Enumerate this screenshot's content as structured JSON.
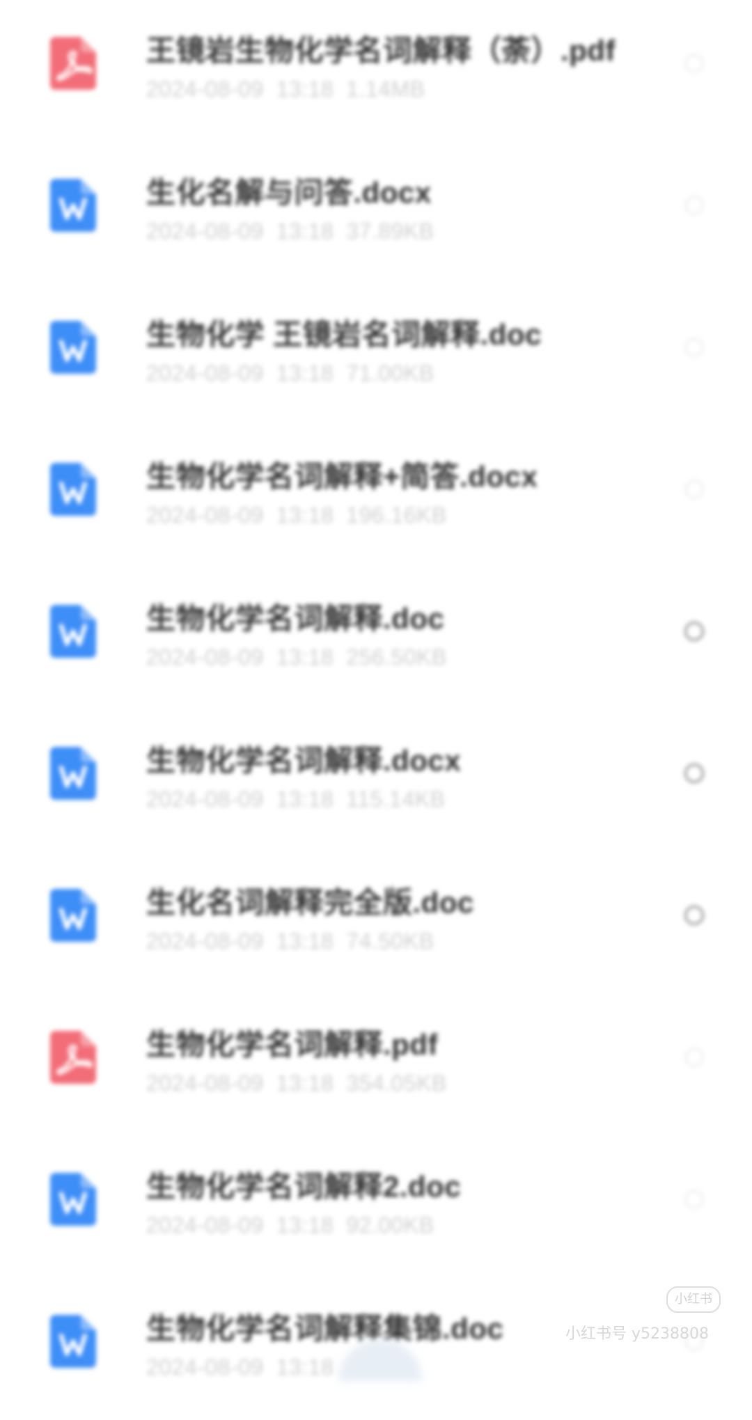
{
  "files": [
    {
      "name": "王镜岩生物化学名词解释（荼）.pdf",
      "date": "2024-08-09",
      "time": "13:18",
      "size": "1.14MB",
      "icon": "pdf-icon"
    },
    {
      "name": "生化名解与问答.docx",
      "date": "2024-08-09",
      "time": "13:18",
      "size": "37.89KB",
      "icon": "word-doc-icon"
    },
    {
      "name": "生物化学 王镜岩名词解释.doc",
      "date": "2024-08-09",
      "time": "13:18",
      "size": "71.00KB",
      "icon": "word-doc-icon"
    },
    {
      "name": "生物化学名词解释+简答.docx",
      "date": "2024-08-09",
      "time": "13:18",
      "size": "196.16KB",
      "icon": "word-doc-icon"
    },
    {
      "name": "生物化学名词解释.doc",
      "date": "2024-08-09",
      "time": "13:18",
      "size": "256.50KB",
      "icon": "word-doc-icon"
    },
    {
      "name": "生物化学名词解释.docx",
      "date": "2024-08-09",
      "time": "13:18",
      "size": "115.14KB",
      "icon": "word-doc-icon"
    },
    {
      "name": "生化名词解释完全版.doc",
      "date": "2024-08-09",
      "time": "13:18",
      "size": "74.50KB",
      "icon": "word-doc-icon"
    },
    {
      "name": "生物化学名词解释.pdf",
      "date": "2024-08-09",
      "time": "13:18",
      "size": "354.05KB",
      "icon": "pdf-icon"
    },
    {
      "name": "生物化学名词解释2.doc",
      "date": "2024-08-09",
      "time": "13:18",
      "size": "92.00KB",
      "icon": "word-doc-icon"
    },
    {
      "name": "生物化学名词解释集锦.doc",
      "date": "2024-08-09",
      "time": "13:18",
      "size": "",
      "icon": "word-doc-icon"
    }
  ],
  "watermark": {
    "logo": "小红书",
    "text": "小红书号 y5238808"
  },
  "colors": {
    "pdf": "#f26d78",
    "word": "#3e8ef7",
    "name_text": "#2d2d2d",
    "meta_text": "#cfcfcf",
    "radio": "#c4c4c4"
  }
}
